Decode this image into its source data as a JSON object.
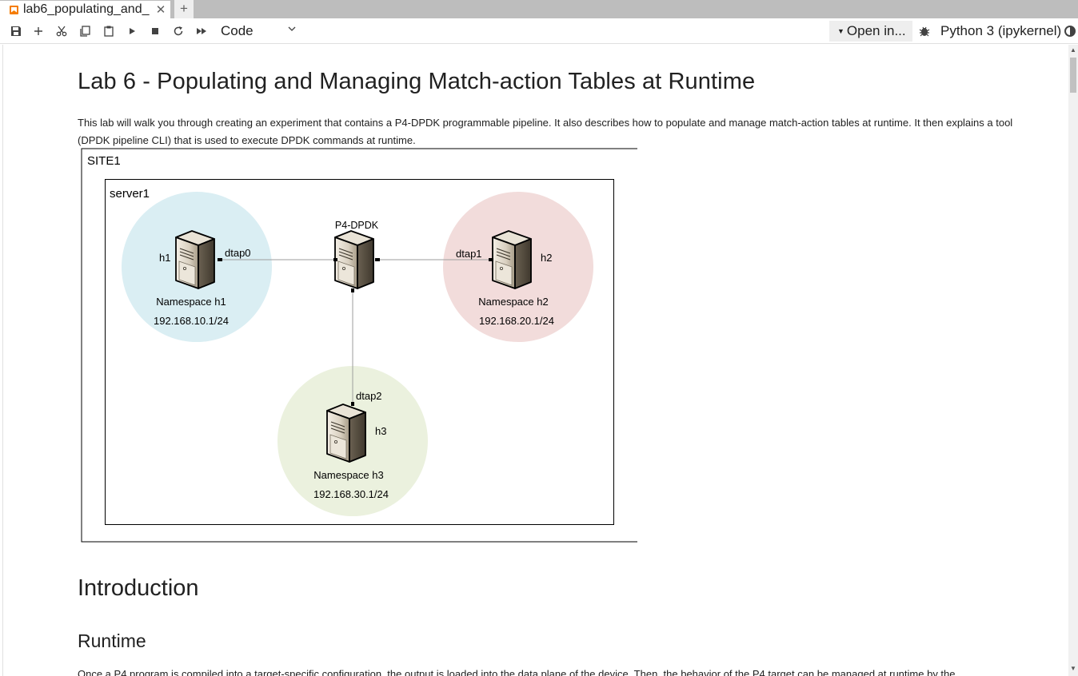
{
  "tab": {
    "title": "lab6_populating_and_",
    "close": "✕",
    "new_tab": "+"
  },
  "toolbar": {
    "cell_type": "Code",
    "open_in": "Open in...",
    "kernel": "Python 3 (ipykernel)"
  },
  "notebook": {
    "title": "Lab 6 - Populating and Managing Match-action Tables at Runtime",
    "intro": "This lab will walk you through creating an experiment that contains a P4-DPDK programmable pipeline. It also describes how to populate and manage match-action tables at runtime. It then explains a tool (DPDK pipeline CLI) that is used to execute DPDK commands at runtime.",
    "h_introduction": "Introduction",
    "h_runtime": "Runtime",
    "runtime_text": "Once a P4 program is compiled into a target-specific configuration, the output is loaded into the data plane of the device. Then, the behavior of the P4 target can be managed at runtime by the"
  },
  "diagram": {
    "site_label": "SITE1",
    "server_label": "server1",
    "switch_label": "P4-DPDK",
    "h1": {
      "host": "h1",
      "iface": "dtap0",
      "ns": "Namespace h1",
      "ip": "192.168.10.1/24",
      "color": "#daeef3"
    },
    "h2": {
      "host": "h2",
      "iface": "dtap1",
      "ns": "Namespace h2",
      "ip": "192.168.20.1/24",
      "color": "#f2dcdb"
    },
    "h3": {
      "host": "h3",
      "iface": "dtap2",
      "ns": "Namespace h3",
      "ip": "192.168.30.1/24",
      "color": "#ebf1de"
    }
  }
}
